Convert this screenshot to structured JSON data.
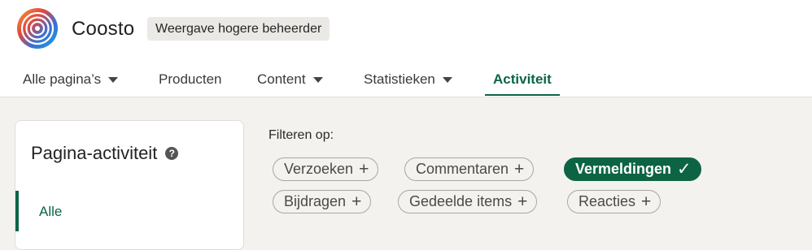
{
  "header": {
    "company_name": "Coosto",
    "view_badge": "Weergave hogere beheerder"
  },
  "nav": {
    "tabs": [
      {
        "label": "Alle pagina’s",
        "has_dropdown": true,
        "active": false
      },
      {
        "label": "Producten",
        "has_dropdown": false,
        "active": false
      },
      {
        "label": "Content",
        "has_dropdown": true,
        "active": false
      },
      {
        "label": "Statistieken",
        "has_dropdown": true,
        "active": false
      },
      {
        "label": "Activiteit",
        "has_dropdown": false,
        "active": true
      }
    ]
  },
  "sidebar": {
    "title": "Pagina-activiteit",
    "help_icon": "?",
    "items": [
      {
        "label": "Alle",
        "selected": true
      }
    ]
  },
  "filters": {
    "label": "Filteren op:",
    "chips": [
      {
        "label": "Verzoeken",
        "symbol": "+",
        "selected": false
      },
      {
        "label": "Commentaren",
        "symbol": "+",
        "selected": false
      },
      {
        "label": "Vermeldingen",
        "symbol": "✓",
        "selected": true
      },
      {
        "label": "Bijdragen",
        "symbol": "+",
        "selected": false
      },
      {
        "label": "Gedeelde items",
        "symbol": "+",
        "selected": false
      },
      {
        "label": "Reacties",
        "symbol": "+",
        "selected": false
      }
    ]
  },
  "colors": {
    "accent": "#0d6445",
    "page_background": "#f4f2ee"
  }
}
